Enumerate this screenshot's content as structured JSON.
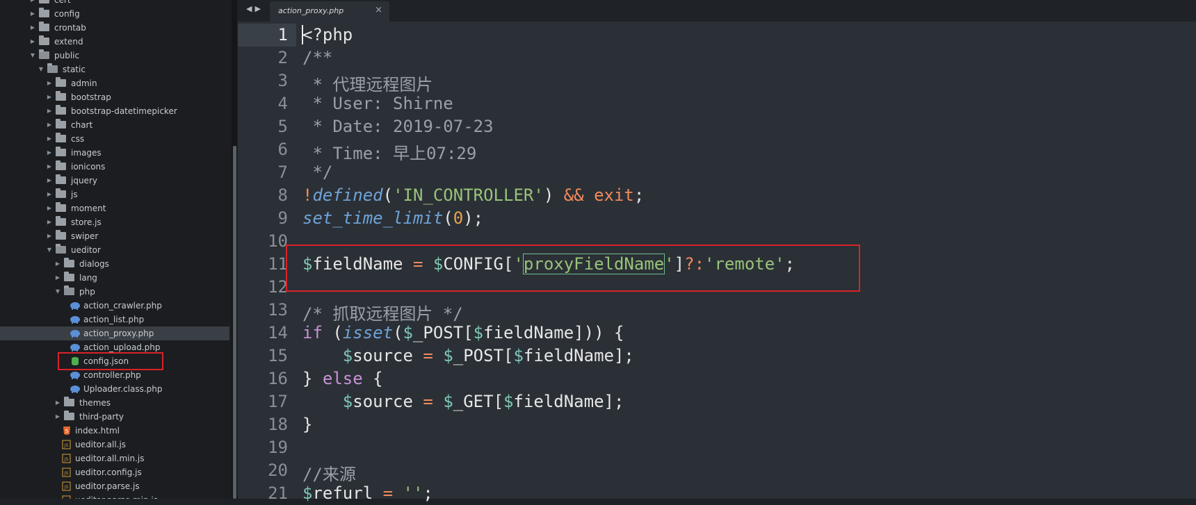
{
  "sidebar": {
    "items": [
      {
        "label": "cert",
        "depth": 0,
        "kind": "folder",
        "open": false
      },
      {
        "label": "config",
        "depth": 0,
        "kind": "folder",
        "open": false
      },
      {
        "label": "crontab",
        "depth": 0,
        "kind": "folder",
        "open": false
      },
      {
        "label": "extend",
        "depth": 0,
        "kind": "folder",
        "open": false
      },
      {
        "label": "public",
        "depth": 0,
        "kind": "folder",
        "open": true
      },
      {
        "label": "static",
        "depth": 1,
        "kind": "folder",
        "open": true
      },
      {
        "label": "admin",
        "depth": 2,
        "kind": "folder",
        "open": false
      },
      {
        "label": "bootstrap",
        "depth": 2,
        "kind": "folder",
        "open": false
      },
      {
        "label": "bootstrap-datetimepicker",
        "depth": 2,
        "kind": "folder",
        "open": false
      },
      {
        "label": "chart",
        "depth": 2,
        "kind": "folder",
        "open": false
      },
      {
        "label": "css",
        "depth": 2,
        "kind": "folder",
        "open": false
      },
      {
        "label": "images",
        "depth": 2,
        "kind": "folder",
        "open": false
      },
      {
        "label": "ionicons",
        "depth": 2,
        "kind": "folder",
        "open": false
      },
      {
        "label": "jquery",
        "depth": 2,
        "kind": "folder",
        "open": false
      },
      {
        "label": "js",
        "depth": 2,
        "kind": "folder",
        "open": false
      },
      {
        "label": "moment",
        "depth": 2,
        "kind": "folder",
        "open": false
      },
      {
        "label": "store.js",
        "depth": 2,
        "kind": "folder",
        "open": false
      },
      {
        "label": "swiper",
        "depth": 2,
        "kind": "folder",
        "open": false
      },
      {
        "label": "ueditor",
        "depth": 2,
        "kind": "folder",
        "open": true
      },
      {
        "label": "dialogs",
        "depth": 3,
        "kind": "folder",
        "open": false
      },
      {
        "label": "lang",
        "depth": 3,
        "kind": "folder",
        "open": false
      },
      {
        "label": "php",
        "depth": 3,
        "kind": "folder",
        "open": true
      },
      {
        "label": "action_crawler.php",
        "depth": 4,
        "kind": "php"
      },
      {
        "label": "action_list.php",
        "depth": 4,
        "kind": "php"
      },
      {
        "label": "action_proxy.php",
        "depth": 4,
        "kind": "php",
        "selected": true
      },
      {
        "label": "action_upload.php",
        "depth": 4,
        "kind": "php"
      },
      {
        "label": "config.json",
        "depth": 4,
        "kind": "json"
      },
      {
        "label": "controller.php",
        "depth": 4,
        "kind": "php"
      },
      {
        "label": "Uploader.class.php",
        "depth": 4,
        "kind": "php"
      },
      {
        "label": "themes",
        "depth": 3,
        "kind": "folder",
        "open": false
      },
      {
        "label": "third-party",
        "depth": 3,
        "kind": "folder",
        "open": false
      },
      {
        "label": "index.html",
        "depth": 3,
        "kind": "html"
      },
      {
        "label": "ueditor.all.js",
        "depth": 3,
        "kind": "js"
      },
      {
        "label": "ueditor.all.min.js",
        "depth": 3,
        "kind": "js"
      },
      {
        "label": "ueditor.config.js",
        "depth": 3,
        "kind": "js"
      },
      {
        "label": "ueditor.parse.js",
        "depth": 3,
        "kind": "js"
      },
      {
        "label": "ueditor.parse.min.js",
        "depth": 3,
        "kind": "js"
      }
    ]
  },
  "tab": {
    "label": "action_proxy.php",
    "close": "×"
  },
  "nav": {
    "back": "◀",
    "forward": "▶"
  },
  "editor": {
    "current_line": 1,
    "lines": [
      {
        "n": "1",
        "tokens": [
          [
            "<?php",
            "c-white"
          ]
        ]
      },
      {
        "n": "2",
        "tokens": [
          [
            "/**",
            "c-cmt"
          ]
        ]
      },
      {
        "n": "3",
        "tokens": [
          [
            " * 代理远程图片",
            "c-cmt"
          ]
        ]
      },
      {
        "n": "4",
        "tokens": [
          [
            " * User: Shirne",
            "c-cmt"
          ]
        ]
      },
      {
        "n": "5",
        "tokens": [
          [
            " * Date: 2019-07-23",
            "c-cmt"
          ]
        ]
      },
      {
        "n": "6",
        "tokens": [
          [
            " * Time: 早上07:29",
            "c-cmt"
          ]
        ]
      },
      {
        "n": "7",
        "tokens": [
          [
            " */",
            "c-cmt"
          ]
        ]
      },
      {
        "n": "8",
        "tokens": [
          [
            "!",
            "c-op"
          ],
          [
            "defined",
            "c-fn"
          ],
          [
            "(",
            "c-white"
          ],
          [
            "'IN_CONTROLLER'",
            "c-str"
          ],
          [
            ") ",
            "c-white"
          ],
          [
            "&&",
            "c-op"
          ],
          [
            " exit",
            "c-op"
          ],
          [
            ";",
            "c-white"
          ]
        ]
      },
      {
        "n": "9",
        "tokens": [
          [
            "set_time_limit",
            "c-fn"
          ],
          [
            "(",
            "c-white"
          ],
          [
            "0",
            "c-num"
          ],
          [
            ");",
            "c-white"
          ]
        ]
      },
      {
        "n": "10",
        "tokens": []
      },
      {
        "n": "11",
        "tokens": [
          [
            "$",
            "c-var"
          ],
          [
            "fieldName ",
            "c-white"
          ],
          [
            "=",
            "c-op"
          ],
          [
            " ",
            "c-white"
          ],
          [
            "$",
            "c-var"
          ],
          [
            "CONFIG[",
            "c-white"
          ],
          [
            "'",
            "c-str"
          ],
          [
            "proxyFieldName",
            "c-str c-sel"
          ],
          [
            "'",
            "c-str"
          ],
          [
            "]",
            "c-white"
          ],
          [
            "?:",
            "c-op"
          ],
          [
            "'remote'",
            "c-str"
          ],
          [
            ";",
            "c-white"
          ]
        ]
      },
      {
        "n": "12",
        "tokens": []
      },
      {
        "n": "13",
        "tokens": [
          [
            "/* 抓取远程图片 */",
            "c-cmt"
          ]
        ]
      },
      {
        "n": "14",
        "tokens": [
          [
            "if",
            "c-key"
          ],
          [
            " (",
            "c-white"
          ],
          [
            "isset",
            "c-fn"
          ],
          [
            "(",
            "c-white"
          ],
          [
            "$",
            "c-var"
          ],
          [
            "_POST[",
            "c-white"
          ],
          [
            "$",
            "c-var"
          ],
          [
            "fieldName])) {",
            "c-white"
          ]
        ]
      },
      {
        "n": "15",
        "tokens": [
          [
            "    ",
            "c-white"
          ],
          [
            "$",
            "c-var"
          ],
          [
            "source ",
            "c-white"
          ],
          [
            "=",
            "c-op"
          ],
          [
            " ",
            "c-white"
          ],
          [
            "$",
            "c-var"
          ],
          [
            "_POST[",
            "c-white"
          ],
          [
            "$",
            "c-var"
          ],
          [
            "fieldName];",
            "c-white"
          ]
        ]
      },
      {
        "n": "16",
        "tokens": [
          [
            "} ",
            "c-white"
          ],
          [
            "else",
            "c-key"
          ],
          [
            " {",
            "c-white"
          ]
        ]
      },
      {
        "n": "17",
        "tokens": [
          [
            "    ",
            "c-white"
          ],
          [
            "$",
            "c-var"
          ],
          [
            "source ",
            "c-white"
          ],
          [
            "=",
            "c-op"
          ],
          [
            " ",
            "c-white"
          ],
          [
            "$",
            "c-var"
          ],
          [
            "_GET[",
            "c-white"
          ],
          [
            "$",
            "c-var"
          ],
          [
            "fieldName];",
            "c-white"
          ]
        ]
      },
      {
        "n": "18",
        "tokens": [
          [
            "}",
            "c-white"
          ]
        ]
      },
      {
        "n": "19",
        "tokens": []
      },
      {
        "n": "20",
        "tokens": [
          [
            "//来源",
            "c-cmt"
          ]
        ]
      },
      {
        "n": "21",
        "tokens": [
          [
            "$",
            "c-var"
          ],
          [
            "refurl ",
            "c-white"
          ],
          [
            "=",
            "c-op"
          ],
          [
            " ",
            "c-white"
          ],
          [
            "''",
            "c-str"
          ],
          [
            ";",
            "c-white"
          ]
        ]
      }
    ]
  },
  "colors": {
    "highlight_box": "#d8232a",
    "php_icon": "#5b8fd6",
    "json_icon": "#4caf50",
    "html_icon": "#e66a2c",
    "js_icon": "#d4a03a"
  }
}
